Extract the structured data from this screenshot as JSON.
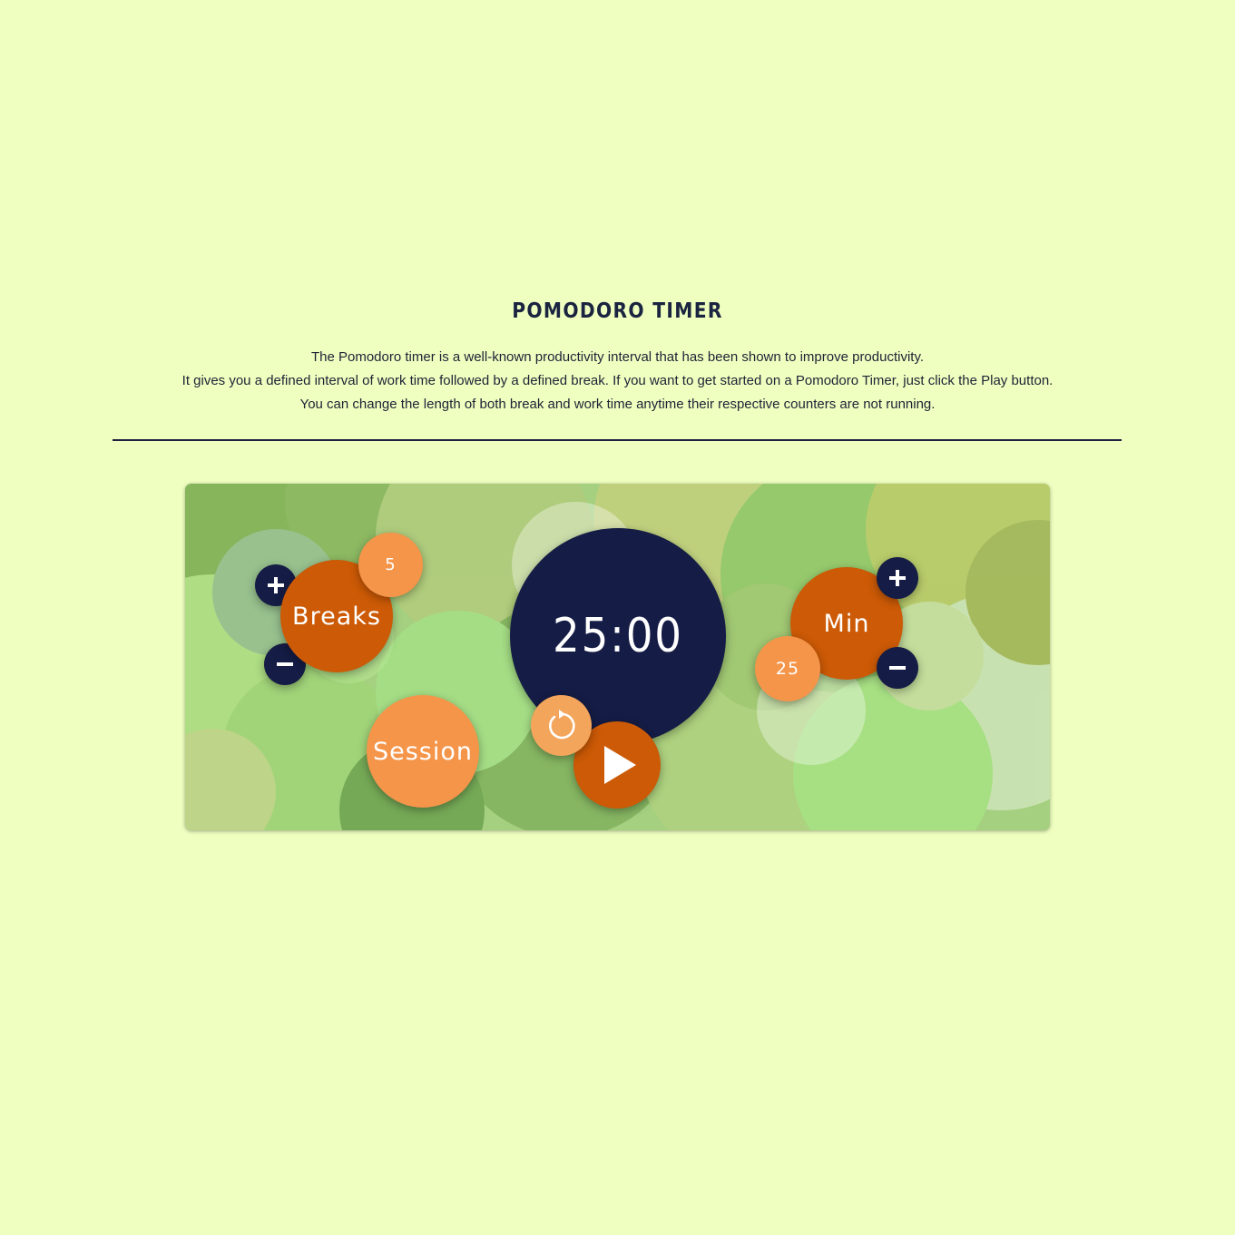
{
  "header": {
    "title": "POMODORO TIMER",
    "description": [
      "The Pomodoro timer is a well-known productivity interval that has been shown to improve productivity.",
      "It gives you a defined interval of work time followed by a defined break. If you want to get started on a Pomodoro Timer, just click the Play button.",
      "You can change the length of both break and work time anytime their respective counters are not running."
    ]
  },
  "timer": {
    "display": "25:00",
    "breaks": {
      "label": "Breaks",
      "value": "5"
    },
    "session": {
      "label": "Session"
    },
    "work": {
      "label": "Min",
      "value": "25"
    }
  },
  "icons": {
    "plus": "plus-icon",
    "minus": "minus-icon",
    "reset": "refresh-icon",
    "play": "play-icon"
  },
  "colors": {
    "background": "#efffc0",
    "dark": "#151c45",
    "accent": "#cc5a06",
    "accent_light": "#f5954a"
  }
}
